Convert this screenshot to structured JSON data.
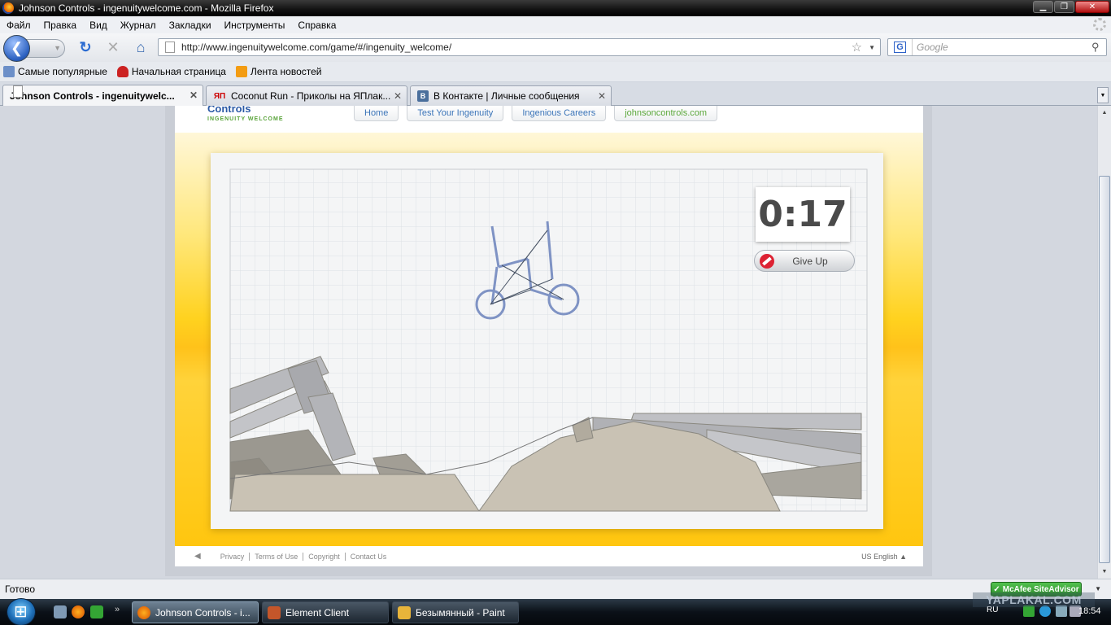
{
  "window": {
    "title": "Johnson Controls - ingenuitywelcome.com - Mozilla Firefox"
  },
  "menu": [
    "Файл",
    "Правка",
    "Вид",
    "Журнал",
    "Закладки",
    "Инструменты",
    "Справка"
  ],
  "nav": {
    "url": "http://www.ingenuitywelcome.com/game/#/ingenuity_welcome/",
    "search_placeholder": "Google",
    "search_engine": "G"
  },
  "bookmarks": [
    "Самые популярные",
    "Начальная страница",
    "Лента новостей"
  ],
  "tabs": [
    {
      "label": "Johnson Controls - ingenuitywelc...",
      "icon": "page-icon",
      "active": true
    },
    {
      "label": "Coconut Run - Приколы на ЯПлак...",
      "icon": "ЯП",
      "active": false
    },
    {
      "label": "В Контакте | Личные сообщения",
      "icon": "B",
      "active": false
    }
  ],
  "site": {
    "logo": "Controls",
    "logo_sub": "INGENUITY WELCOME",
    "nav": [
      "Home",
      "Test Your Ingenuity",
      "Ingenious Careers",
      "johnsoncontrols.com"
    ],
    "game": {
      "timer": "0:17",
      "give_up": "Give Up"
    },
    "footer": {
      "links": [
        "Privacy",
        "Terms of Use",
        "Copyright",
        "Contact Us"
      ],
      "language": "US English ▲"
    }
  },
  "status": {
    "text": "Готово",
    "mcafee": "McAfee SiteAdvisor"
  },
  "taskbar": {
    "tasks": [
      "Johnson Controls - i...",
      "Element Client",
      "Безымянный - Paint"
    ],
    "lang": "RU",
    "clock": "18:54",
    "quicklaunch_more": "»"
  },
  "watermark": "YAPLAKAL.COM",
  "colors": {
    "stage_yellow": "#ffc60f",
    "link_blue": "#3a74b8",
    "link_green": "#5aa73a",
    "bike": "#7f93c4"
  }
}
